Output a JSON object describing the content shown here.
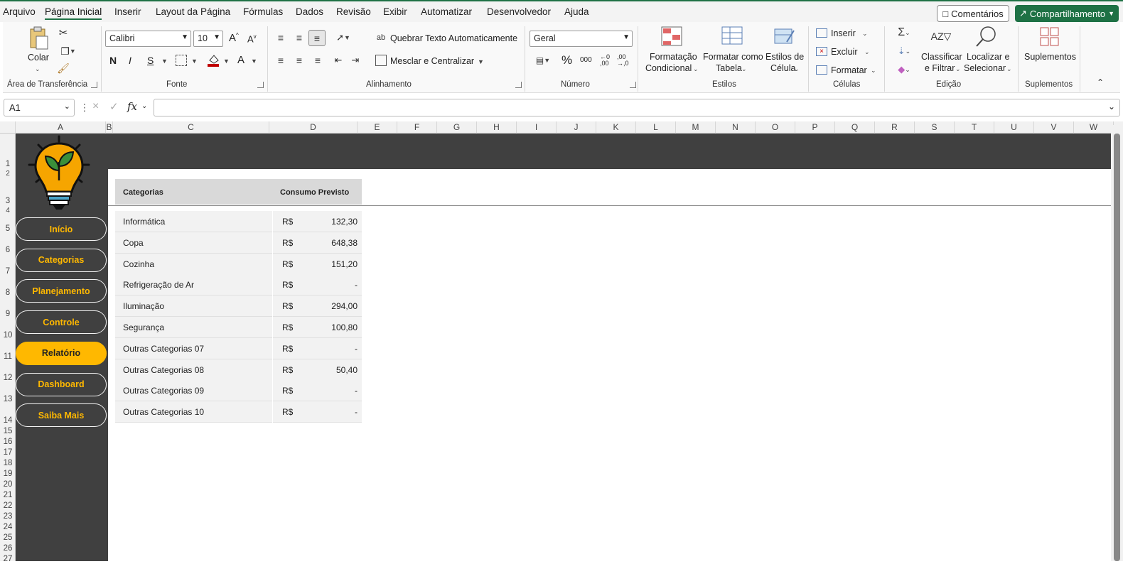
{
  "menu": {
    "tabs": [
      "Arquivo",
      "Página Inicial",
      "Inserir",
      "Layout da Página",
      "Fórmulas",
      "Dados",
      "Revisão",
      "Exibir",
      "Automatizar",
      "Desenvolvedor",
      "Ajuda"
    ],
    "comments_label": "Comentários",
    "share_label": "Compartilhamento"
  },
  "ribbon": {
    "clipboard": {
      "paste_label": "Colar",
      "group_label": "Área de Transferência"
    },
    "font": {
      "name": "Calibri",
      "size": "10",
      "group_label": "Fonte",
      "bold": "N",
      "italic": "I",
      "underline": "S"
    },
    "alignment": {
      "wrap_label": "Quebrar Texto Automaticamente",
      "merge_label": "Mesclar e Centralizar",
      "group_label": "Alinhamento"
    },
    "number": {
      "format": "Geral",
      "group_label": "Número"
    },
    "styles": {
      "conditional_l1": "Formatação",
      "conditional_l2": "Condicional",
      "table_l1": "Formatar como",
      "table_l2": "Tabela",
      "cell_l1": "Estilos de",
      "cell_l2": "Célula",
      "group_label": "Estilos"
    },
    "cells": {
      "insert": "Inserir",
      "delete": "Excluir",
      "format": "Formatar",
      "group_label": "Células"
    },
    "editing": {
      "sort_l1": "Classificar",
      "sort_l2": "e Filtrar",
      "find_l1": "Localizar e",
      "find_l2": "Selecionar",
      "group_label": "Edição"
    },
    "addins": {
      "label": "Suplementos",
      "group_label": "Suplementos"
    }
  },
  "formula_bar": {
    "cell_ref": "A1",
    "fx": "fx",
    "value": ""
  },
  "columns": [
    "A",
    "B",
    "C",
    "D",
    "E",
    "F",
    "G",
    "H",
    "I",
    "J",
    "K",
    "L",
    "M",
    "N",
    "O",
    "P",
    "Q",
    "R",
    "S",
    "T",
    "U",
    "V",
    "W"
  ],
  "rows": [
    "1",
    "2",
    "3",
    "4",
    "5",
    "6",
    "7",
    "8",
    "9",
    "10",
    "11",
    "12",
    "13",
    "14",
    "15",
    "16",
    "17",
    "18",
    "19",
    "20",
    "21",
    "22",
    "23",
    "24",
    "25",
    "26",
    "27"
  ],
  "sidebar": {
    "items": [
      {
        "label": "Início",
        "active": false
      },
      {
        "label": "Categorias",
        "active": false
      },
      {
        "label": "Planejamento",
        "active": false
      },
      {
        "label": "Controle",
        "active": false
      },
      {
        "label": "Relatório",
        "active": true
      },
      {
        "label": "Dashboard",
        "active": false
      },
      {
        "label": "Saiba Mais",
        "active": false
      }
    ]
  },
  "table": {
    "headers": [
      "Categorias",
      "Consumo Previsto"
    ],
    "currency": "R$",
    "rows": [
      {
        "category": "Informática",
        "value": "132,30"
      },
      {
        "category": "Copa",
        "value": "648,38"
      },
      {
        "category": "Cozinha",
        "value": "151,20"
      },
      {
        "category": "Refrigeração de Ar",
        "value": "-"
      },
      {
        "category": "Iluminação",
        "value": "294,00"
      },
      {
        "category": "Segurança",
        "value": "100,80"
      },
      {
        "category": "Outras Categorias 07",
        "value": "-"
      },
      {
        "category": "Outras Categorias 08",
        "value": "50,40"
      },
      {
        "category": "Outras Categorias 09",
        "value": "-"
      },
      {
        "category": "Outras Categorias 10",
        "value": "-"
      }
    ]
  },
  "colors": {
    "accent": "#1e7145",
    "nav_text": "#ffb800",
    "dark_bg": "#404040"
  }
}
